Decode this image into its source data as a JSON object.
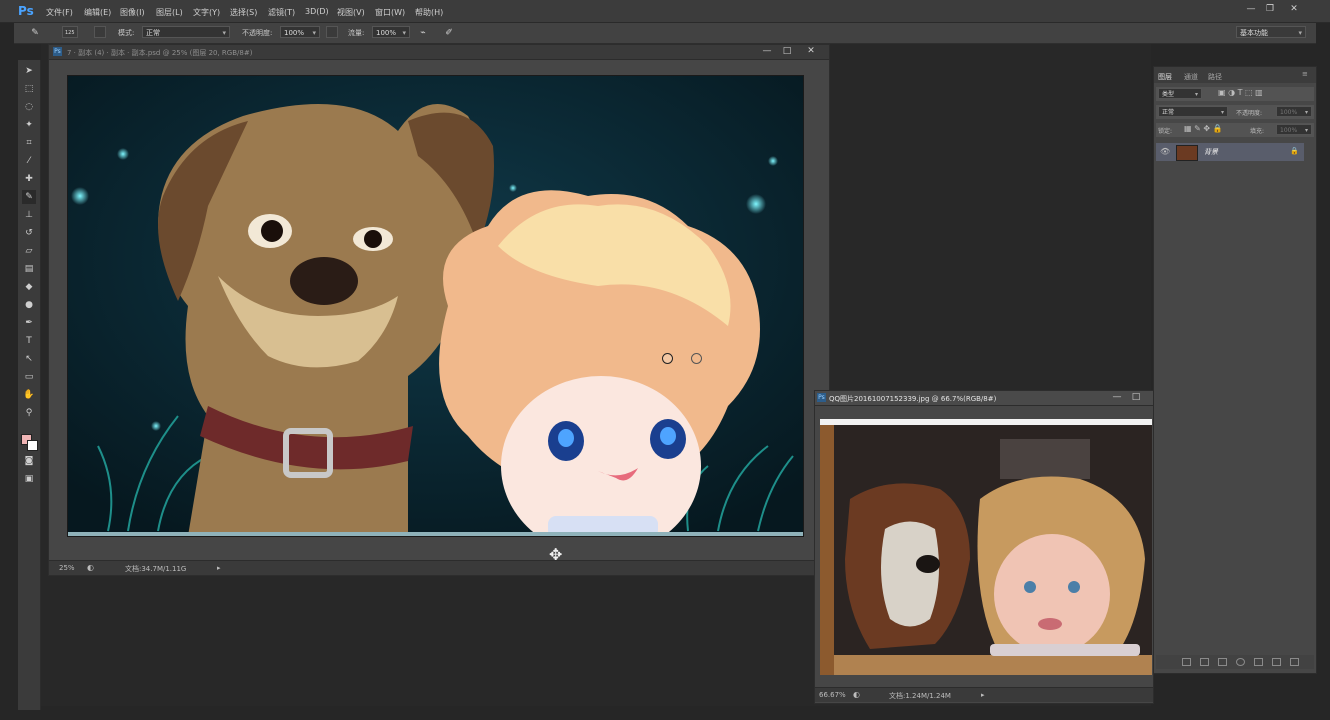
{
  "app": {
    "logo": "Ps",
    "accent": "#31a8ff"
  },
  "menu": [
    "文件(F)",
    "编辑(E)",
    "图像(I)",
    "图层(L)",
    "文字(Y)",
    "选择(S)",
    "滤镜(T)",
    "3D(D)",
    "视图(V)",
    "窗口(W)",
    "帮助(H)"
  ],
  "options": {
    "brush_size": "125",
    "mode_label": "模式:",
    "mode_value": "正常",
    "opacity_label": "不透明度:",
    "opacity_value": "100%",
    "flow_label": "流量:",
    "flow_value": "100%",
    "workspace": "基本功能"
  },
  "doc1": {
    "title": "7 · 副本 (4) · 副本 · 副本.psd @ 25% (图层 20, RGB/8#)",
    "zoom": "25%",
    "doc_size": "文档:34.7M/1.11G"
  },
  "doc2": {
    "title": "QQ图片20161007152339.jpg @ 66.7%(RGB/8#)",
    "zoom": "66.67%",
    "doc_size": "文档:1.24M/1.24M"
  },
  "layers_panel": {
    "tabs": [
      "图层",
      "通道",
      "路径"
    ],
    "filter_kind": "类型",
    "blend_mode": "正常",
    "opacity_label": "不透明度:",
    "opacity_value": "100%",
    "lock_label": "锁定:",
    "fill_label": "填充:",
    "fill_value": "100%",
    "layer_name": "背景"
  },
  "icons": [
    "move-icon",
    "marquee-icon",
    "lasso-icon",
    "magic-wand-icon",
    "crop-icon",
    "eyedropper-icon",
    "healing-icon",
    "brush-icon",
    "stamp-icon",
    "history-brush-icon",
    "eraser-icon",
    "gradient-icon",
    "blur-icon",
    "dodge-icon",
    "pen-icon",
    "type-icon",
    "path-select-icon",
    "shape-icon",
    "hand-icon",
    "zoom-icon"
  ]
}
